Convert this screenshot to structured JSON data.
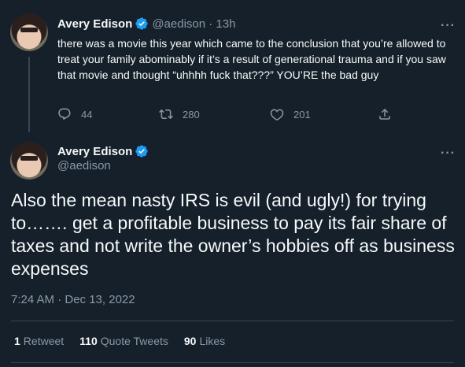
{
  "tweet1": {
    "author_name": "Avery Edison",
    "handle_time": "@aedison · 13h",
    "text": "there was a movie this year which came to the conclusion that you’re allowed to treat your family abominably if it’s a result of generational trauma and if you saw that movie and thought “uhhhh fuck that???” YOU’RE the bad guy",
    "replies": "44",
    "retweets": "280",
    "likes": "201",
    "more": "···"
  },
  "tweet2": {
    "author_name": "Avery Edison",
    "handle": "@aedison",
    "text": "Also the mean nasty IRS is evil (and ugly!) for trying to……. get a profitable business to pay its fair share of taxes and not write the owner’s hobbies off as business expenses",
    "timestamp": "7:24 AM · Dec 13, 2022",
    "more": "···",
    "stats": {
      "retweets_num": "1",
      "retweets_label": "Retweet",
      "quotes_num": "110",
      "quotes_label": "Quote Tweets",
      "likes_num": "90",
      "likes_label": "Likes"
    }
  },
  "colors": {
    "background": "#15202b",
    "text": "#f7f9f9",
    "secondary": "#8b98a5",
    "verified": "#1d9bf0",
    "divider": "#38444d"
  },
  "icons": [
    "verified-icon",
    "reply-icon",
    "retweet-icon",
    "like-icon",
    "share-icon",
    "more-icon"
  ]
}
